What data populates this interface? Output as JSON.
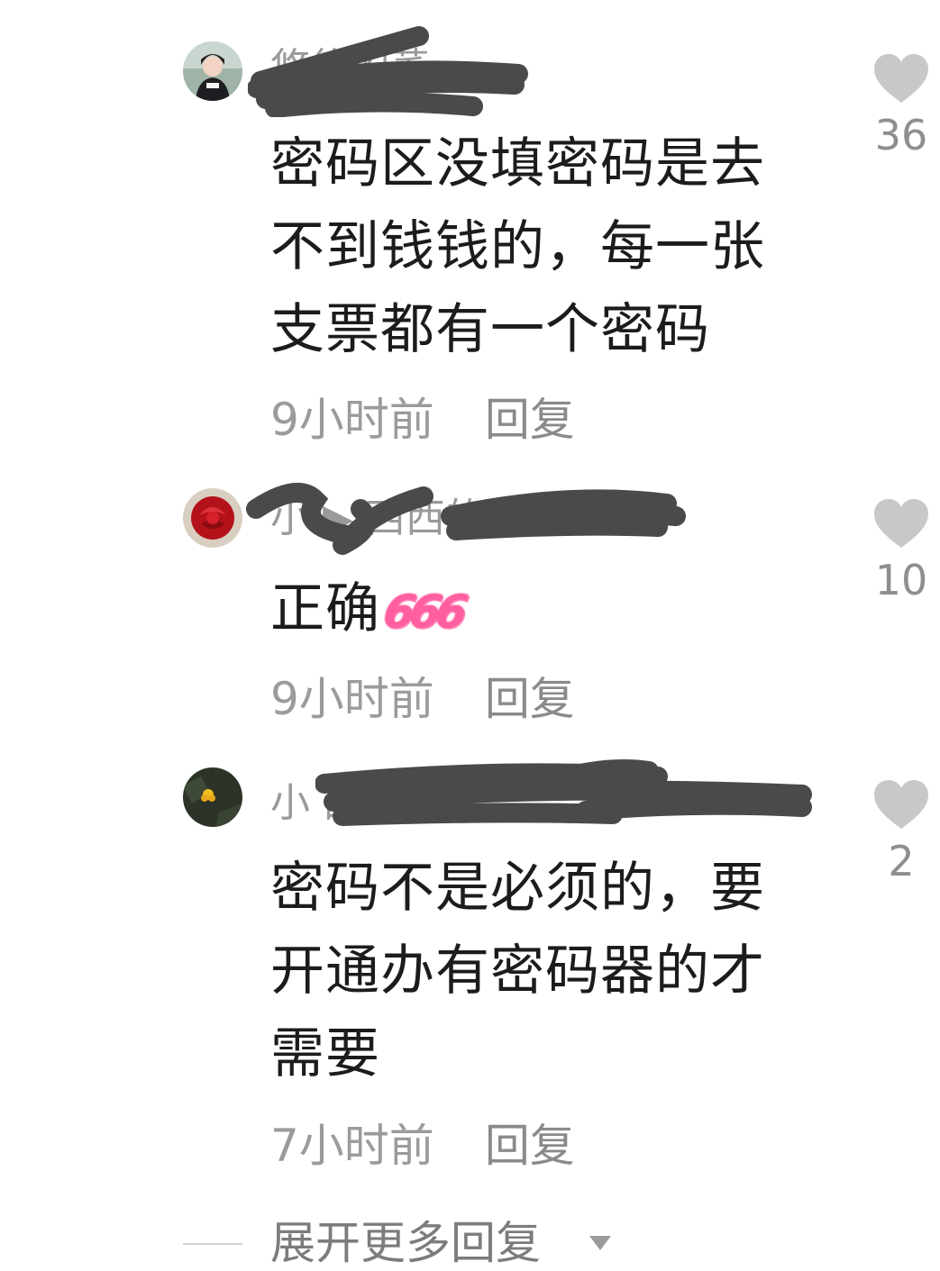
{
  "comments": [
    {
      "username": "悠悠的荞",
      "text_lines": [
        "密码区没填密码是去",
        "不到钱钱的，每一张",
        "支票都有一个密码"
      ],
      "time": "9小时前",
      "reply_label": "回复",
      "likes": "36",
      "avatar": "woman-portrait-avatar"
    },
    {
      "username": "小 ▶ 西西的荞",
      "text_lines": [
        "正确"
      ],
      "emoji": "666",
      "time": "9小时前",
      "reply_label": "回复",
      "likes": "10",
      "avatar": "red-rose-avatar"
    },
    {
      "username": "小 西西的荞",
      "text_lines": [
        "密码不是必须的，要",
        "开通办有密码器的才",
        "需要"
      ],
      "time": "7小时前",
      "reply_label": "回复",
      "likes": "2",
      "avatar": "yellow-flower-avatar"
    }
  ],
  "expand_label": "展开更多回复",
  "colors": {
    "like_heart": "#c8c8c8",
    "muted_text": "#9b9b9b",
    "emoji_pink": "#ff5fa0",
    "redaction": "#4a4a4a"
  }
}
